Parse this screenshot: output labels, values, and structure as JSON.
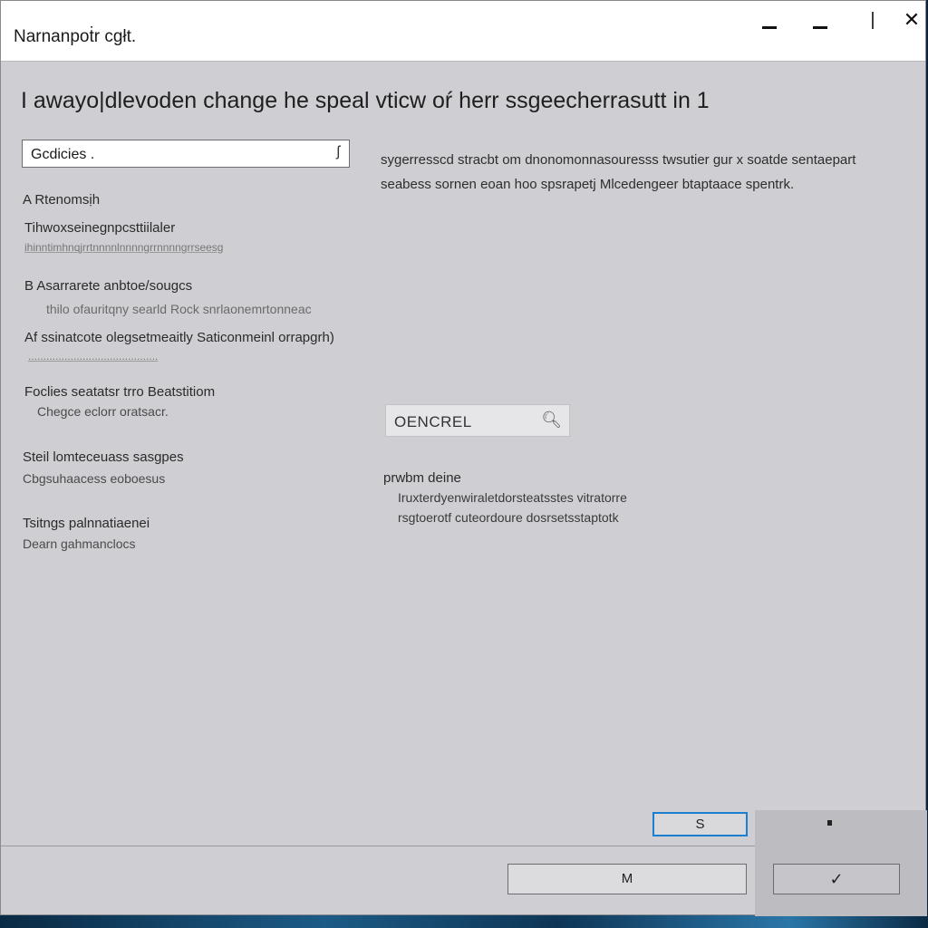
{
  "window": {
    "title": "Narnanpoṫr cgłt.",
    "controls": {
      "minimize": "–",
      "minimize2": "–",
      "restore": "|",
      "close": "✕"
    }
  },
  "main": {
    "heading": "I awayo|dlevoden change he speal vticw oŕ herr ssgeecherrasutt in 1"
  },
  "select": {
    "value": "Gcdicies .",
    "chevron": "ʃ"
  },
  "left_options": [
    {
      "label": "A Rtenomsịh",
      "sub": ""
    },
    {
      "label": "Tihwoxseinegnpcsttiilaler",
      "sub": "ihinntimhnqjrrtnnnnlnnnngrrnnnngrrseesg"
    },
    {
      "label": "B Asarrarete anbtoe/sougcs",
      "sub": "thilo ofauritqny searld Rock snrlaonemrtonneac"
    },
    {
      "label": "Af ssinatcote olegsetmeaitly Saticonmeinl orrapgrh)",
      "sub": "..........................................."
    },
    {
      "label": "Foclies seatatsr trro Beatstitiom",
      "sub": "Chegce eclorr oratsacr."
    },
    {
      "label": "Steil lomteceuass sasgpes",
      "sub": "Cbgsuhaacess eoboesus"
    },
    {
      "label": "Tsitngs palnnatiaenei",
      "sub": "Dearn gahmanclocs"
    }
  ],
  "description": "sygerresscd stracbt om dnonomonnasouresss twsutier gur x soatde sentaepart seabess sornen eoan hoo spsrapetj Mlcedengeer btaptaace spentrk.",
  "cancel_field": {
    "label": "OENCREL",
    "icon": "search-icon"
  },
  "info": {
    "title": "prwbm deine",
    "lines": [
      "Iruxterdyenwiraletdorsteatsstes vitratorre",
      "rsgtoerotf cuteordoure dosrsetsstaptotk"
    ]
  },
  "footer": {
    "small_button": "S",
    "mid_button": "M",
    "confirm_button": "✓"
  },
  "colors": {
    "accent": "#1a7fd0",
    "window_bg": "#cfcfd3",
    "titlebar_bg": "#ffffff"
  }
}
